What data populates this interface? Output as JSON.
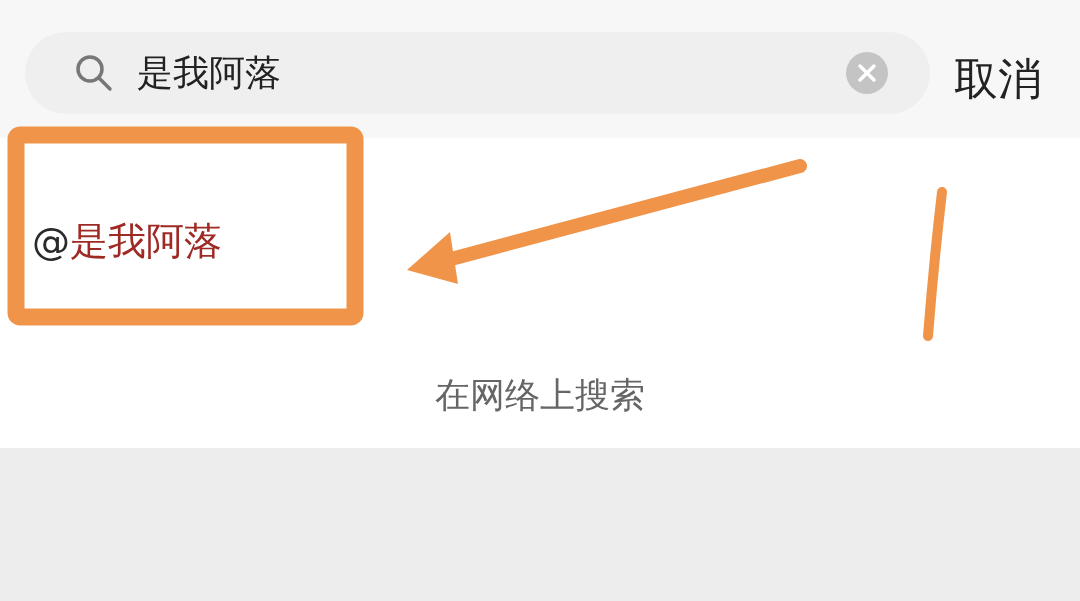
{
  "search": {
    "value": "是我阿落",
    "cancel": "取消"
  },
  "result": {
    "prefix": "@",
    "name": "是我阿落"
  },
  "web_search": "在网络上搜索",
  "annotations": [
    {
      "kind": "box"
    },
    {
      "kind": "arrow"
    },
    {
      "kind": "stroke"
    }
  ]
}
